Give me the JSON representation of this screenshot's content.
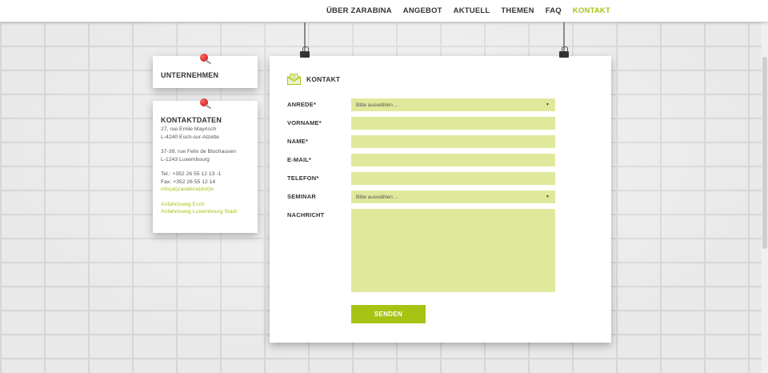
{
  "nav": {
    "items": [
      "ÜBER ZARABINA",
      "ANGEBOT",
      "AKTUELL",
      "THEMEN",
      "FAQ",
      "KONTAKT"
    ],
    "active": "KONTAKT"
  },
  "colors": {
    "accent": "#a4c417",
    "field_bg": "#e0e99b",
    "button_bg": "#a6c414",
    "pin": "#d00000"
  },
  "sidebar": {
    "company_card": {
      "title": "UNTERNEHMEN"
    },
    "contact_card": {
      "title": "KONTAKTDATEN",
      "address1": [
        "27, rue Emile Mayrisch",
        "L-4240 Esch-sur-Alzette"
      ],
      "address2": [
        "37-39, rue Felix de Blochausen",
        "L-1243 Luxembourg"
      ],
      "phone": "Tel.: +352 26 55 12 13 -1",
      "fax": "Fax: +352 26 55 12 14",
      "email": "info(at)zarabina(dot)lu",
      "links": [
        "Anfahrtsweg Esch",
        "Anfahrtsweg Luxembourg Stadt"
      ]
    }
  },
  "form": {
    "title": "KONTAKT",
    "icon": "envelope-icon",
    "fields": {
      "anrede": {
        "label": "ANREDE*",
        "value": "Bitte auswählen ..."
      },
      "vorname": {
        "label": "VORNAME*",
        "value": ""
      },
      "name": {
        "label": "NAME*",
        "value": ""
      },
      "email": {
        "label": "E-MAIL*",
        "value": ""
      },
      "telefon": {
        "label": "TELEFON*",
        "value": ""
      },
      "seminar": {
        "label": "SEMINAR",
        "value": "Bitte auswählen ..."
      },
      "nachricht": {
        "label": "NACHRICHT",
        "value": ""
      }
    },
    "submit_label": "SENDEN"
  }
}
